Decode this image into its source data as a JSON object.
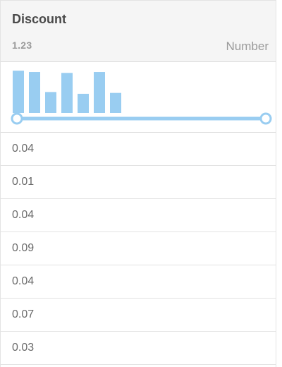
{
  "column": {
    "title": "Discount",
    "type_glyph": "1.23",
    "type_label": "Number"
  },
  "histogram": {
    "bar_color": "#99cdf1",
    "slider_color": "#99cdf1",
    "bars": [
      0.95,
      0.92,
      0.47,
      0.9,
      0.43,
      0.92,
      0.45
    ]
  },
  "values": [
    "0.04",
    "0.01",
    "0.04",
    "0.09",
    "0.04",
    "0.07",
    "0.03"
  ]
}
